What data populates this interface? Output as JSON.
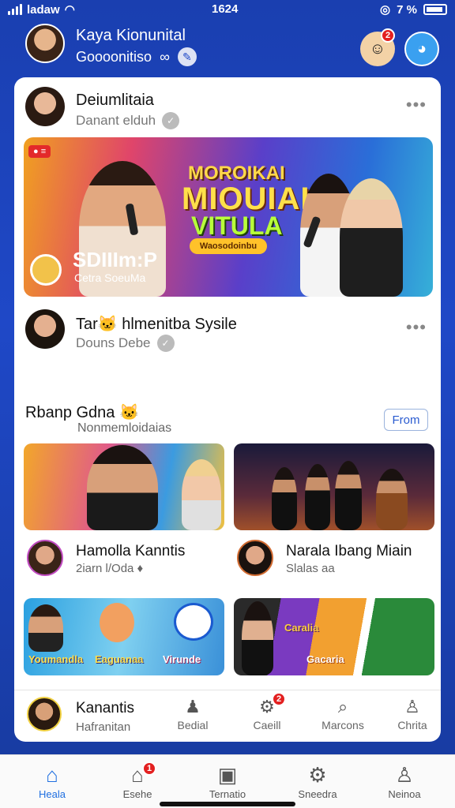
{
  "status": {
    "carrier": "ladaw",
    "time": "1624",
    "battery_pct": "7 %"
  },
  "header": {
    "name": "Kaya Kionunital",
    "subtitle": "Goooonitiso",
    "sub_glyph": "∞",
    "face_badge": "2"
  },
  "post1": {
    "name": "Deiumlitaia",
    "sub": "Danant elduh"
  },
  "banner": {
    "tag": "● ≡",
    "title1": "MOROIKAI",
    "title2": "MIOUIAL",
    "title3": "VITULA",
    "cta": "Waosodoinbu",
    "live": "SDIIIm:P",
    "live_sub": "Cetra SoeuMa"
  },
  "post2": {
    "name": "Tar🐱 hlmenitba Sysile",
    "sub": "Douns Debe"
  },
  "section": {
    "title": "Rbanp Gdna 🐱",
    "subtitle": "Nonmemloidaias",
    "button": "From"
  },
  "tiles": [
    {
      "name": "Hamolla Kanntis",
      "sub": "2iarn l/Oda ♦"
    },
    {
      "name": "Narala Ibang Miain",
      "sub": "Slalas aa"
    }
  ],
  "tile_labels": {
    "c1": "Youmandla",
    "c2": "Eaguanaa",
    "c3": "Virunde",
    "d1": "Caralia",
    "d2": "Gacaria"
  },
  "strip": {
    "name": "Kanantis",
    "sub": "Hafranitan",
    "items": [
      {
        "label": "Bedial",
        "icon": "person-icon"
      },
      {
        "label": "Caeill",
        "icon": "group-icon",
        "badge": "2"
      },
      {
        "label": "Marcons",
        "icon": "search-icon"
      },
      {
        "label": "Chrita",
        "icon": "user-icon"
      }
    ]
  },
  "tabs": [
    {
      "label": "Heala",
      "icon": "home-icon",
      "active": true
    },
    {
      "label": "Esehe",
      "icon": "shop-icon",
      "badge": "1"
    },
    {
      "label": "Ternatio",
      "icon": "message-icon"
    },
    {
      "label": "Sneedra",
      "icon": "settings-icon"
    },
    {
      "label": "Neinoa",
      "icon": "profile-icon"
    }
  ]
}
